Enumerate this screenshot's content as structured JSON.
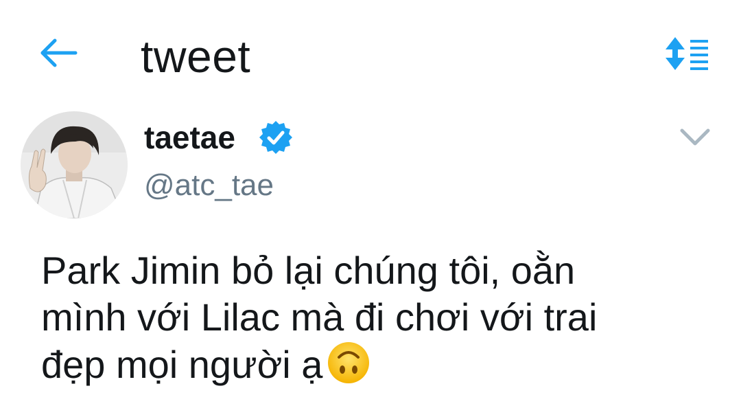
{
  "header": {
    "title": "tweet",
    "back_icon": "back-arrow-icon",
    "sort_icon": "sort-lines-icon",
    "accent_color": "#1da1f2"
  },
  "tweet": {
    "author": {
      "display_name": "taetae",
      "handle": "@atc_tae",
      "verified": true,
      "verified_icon": "verified-badge-icon"
    },
    "menu_icon": "chevron-down-icon",
    "text_lines": [
      "Park Jimin bỏ lại chúng tôi, oằn",
      "mình với Lilac mà đi chơi với trai",
      "đẹp mọi người ạ"
    ],
    "emoji": "upside-down-face-emoji"
  },
  "colors": {
    "primary_text": "#14171a",
    "secondary_text": "#657786",
    "accent": "#1da1f2",
    "chevron": "#aab8c2"
  }
}
